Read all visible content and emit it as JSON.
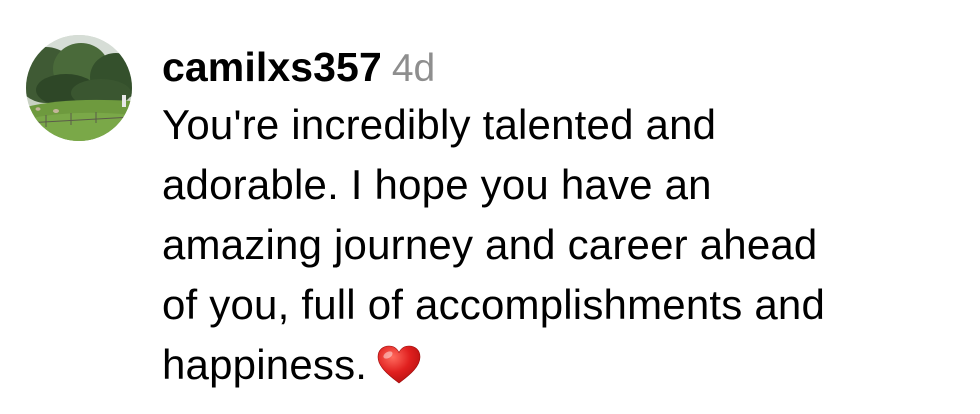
{
  "comment": {
    "username": "camilxs357",
    "timestamp": "4d",
    "text_lines": [
      "You're incredibly talented and",
      "adorable. I hope you have an",
      "amazing journey and career ahead",
      "of you, full of accomplishments and",
      "happiness."
    ],
    "emoji": "heart-emoji"
  },
  "colors": {
    "text": "#000000",
    "timestamp": "#8e8e8e",
    "heart": "#e0201f",
    "background": "#ffffff"
  }
}
